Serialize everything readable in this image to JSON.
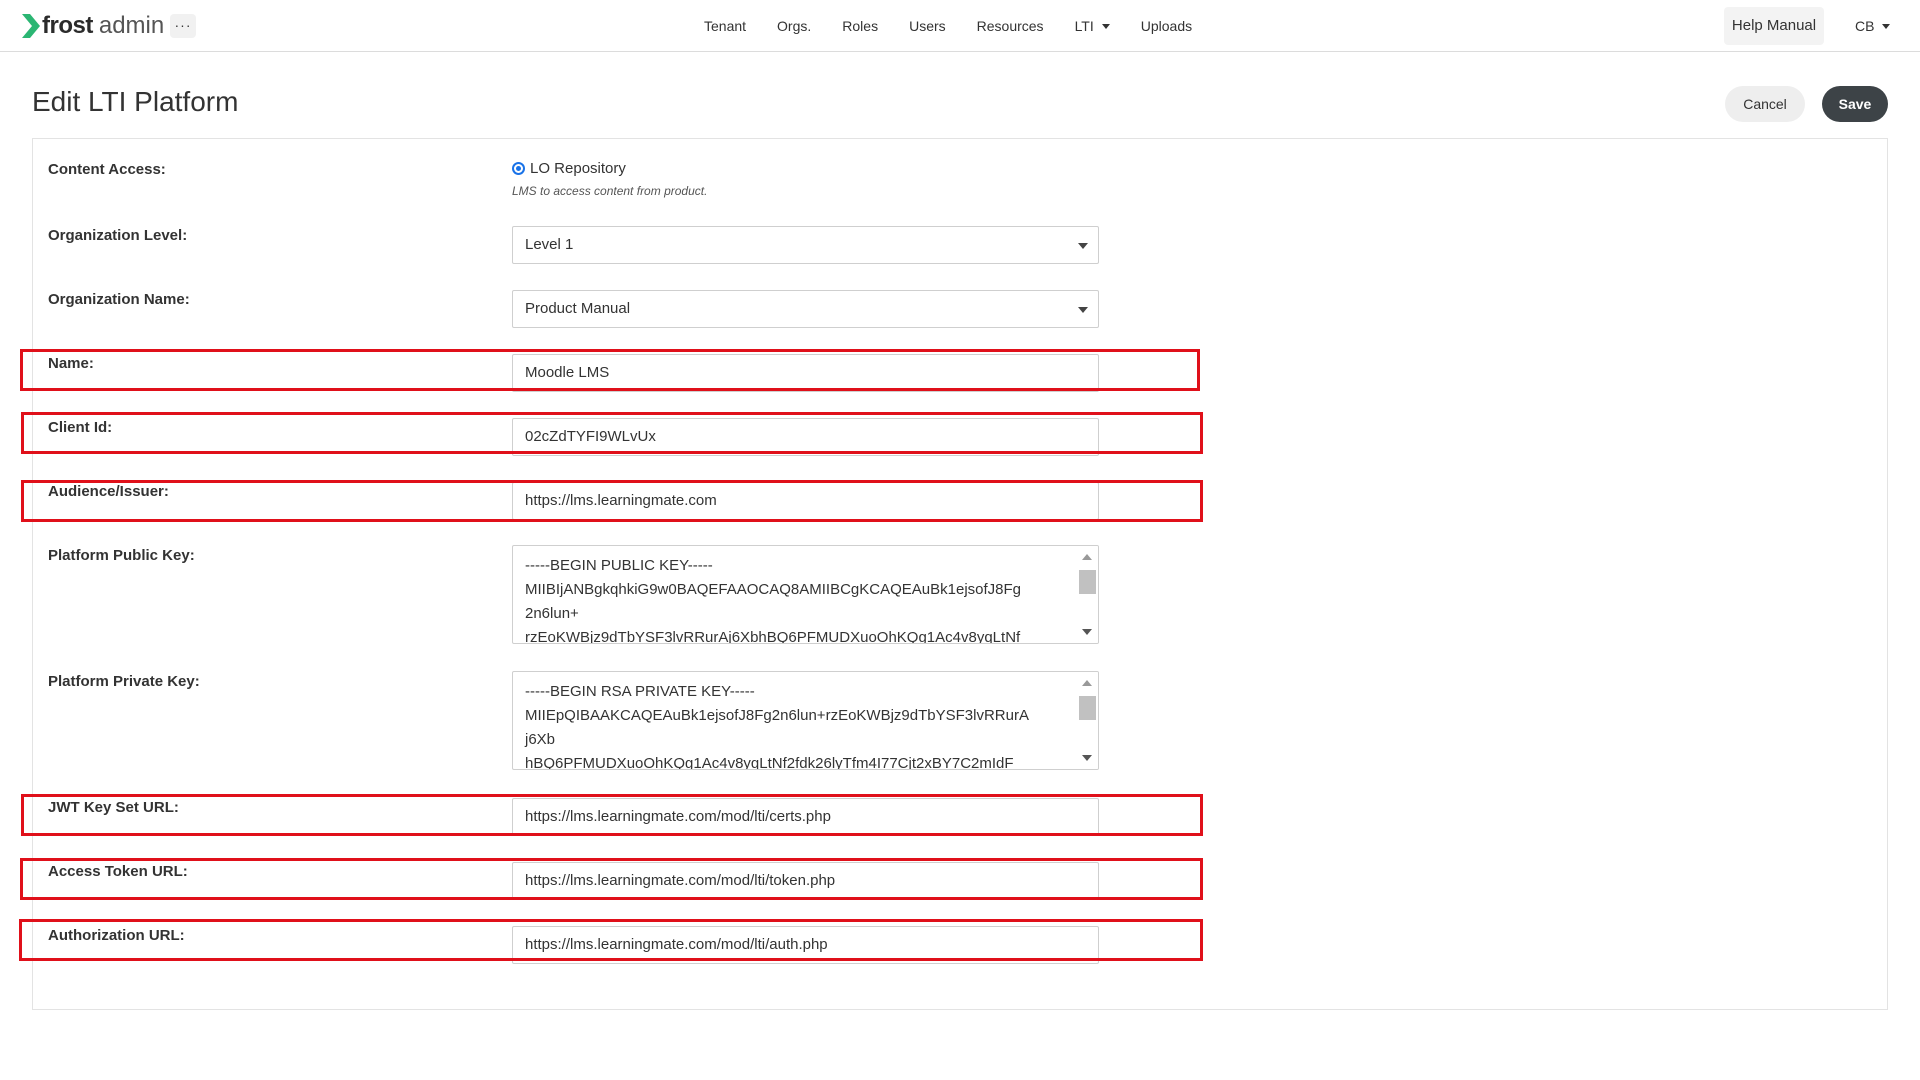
{
  "app": {
    "logo_frost": "frost",
    "logo_admin": "admin",
    "more_label": "···",
    "brand_color": "#2bb673"
  },
  "nav": {
    "items": [
      {
        "label": "Tenant"
      },
      {
        "label": "Orgs."
      },
      {
        "label": "Roles"
      },
      {
        "label": "Users"
      },
      {
        "label": "Resources"
      },
      {
        "label": "LTI",
        "has_dropdown": true
      },
      {
        "label": "Uploads"
      }
    ],
    "help_label": "Help Manual",
    "user_initials": "CB"
  },
  "page": {
    "title": "Edit LTI Platform",
    "cancel_label": "Cancel",
    "save_label": "Save"
  },
  "form": {
    "content_access": {
      "label": "Content Access:",
      "option_label": "LO Repository",
      "option_selected": true,
      "hint": "LMS to access content from product."
    },
    "organization_level": {
      "label": "Organization Level:",
      "value": "Level 1"
    },
    "organization_name": {
      "label": "Organization Name:",
      "value": "Product Manual"
    },
    "name": {
      "label": "Name:",
      "value": "Moodle LMS"
    },
    "client_id": {
      "label": "Client Id:",
      "value": "02cZdTYFI9WLvUx"
    },
    "audience": {
      "label": "Audience/Issuer:",
      "value": "https://lms.learningmate.com"
    },
    "public_key": {
      "label": "Platform Public Key:",
      "lines": [
        "-----BEGIN PUBLIC KEY-----",
        "MIIBIjANBgkqhkiG9w0BAQEFAAOCAQ8AMIIBCgKCAQEAuBk1ejsofJ8Fg",
        "2n6lun+",
        "rzEoKWBjz9dTbYSF3lvRRurAj6XbhBQ6PFMUDXuoOhKQg1Ac4v8yqLtNf"
      ]
    },
    "private_key": {
      "label": "Platform Private Key:",
      "lines": [
        "-----BEGIN RSA PRIVATE KEY-----",
        "MIIEpQIBAAKCAQEAuBk1ejsofJ8Fg2n6lun+rzEoKWBjz9dTbYSF3lvRRurA",
        "j6Xb",
        "hBQ6PFMUDXuoOhKQg1Ac4v8yqLtNf2fdk26lyTfm4I77Cjt2xBY7C2mIdF"
      ]
    },
    "jwks_url": {
      "label": "JWT Key Set URL:",
      "value": "https://lms.learningmate.com/mod/lti/certs.php"
    },
    "token_url": {
      "label": "Access Token URL:",
      "value": "https://lms.learningmate.com/mod/lti/token.php"
    },
    "auth_url": {
      "label": "Authorization URL:",
      "value": "https://lms.learningmate.com/mod/lti/auth.php"
    }
  },
  "annotation": {
    "highlight_color": "#e0101a"
  }
}
